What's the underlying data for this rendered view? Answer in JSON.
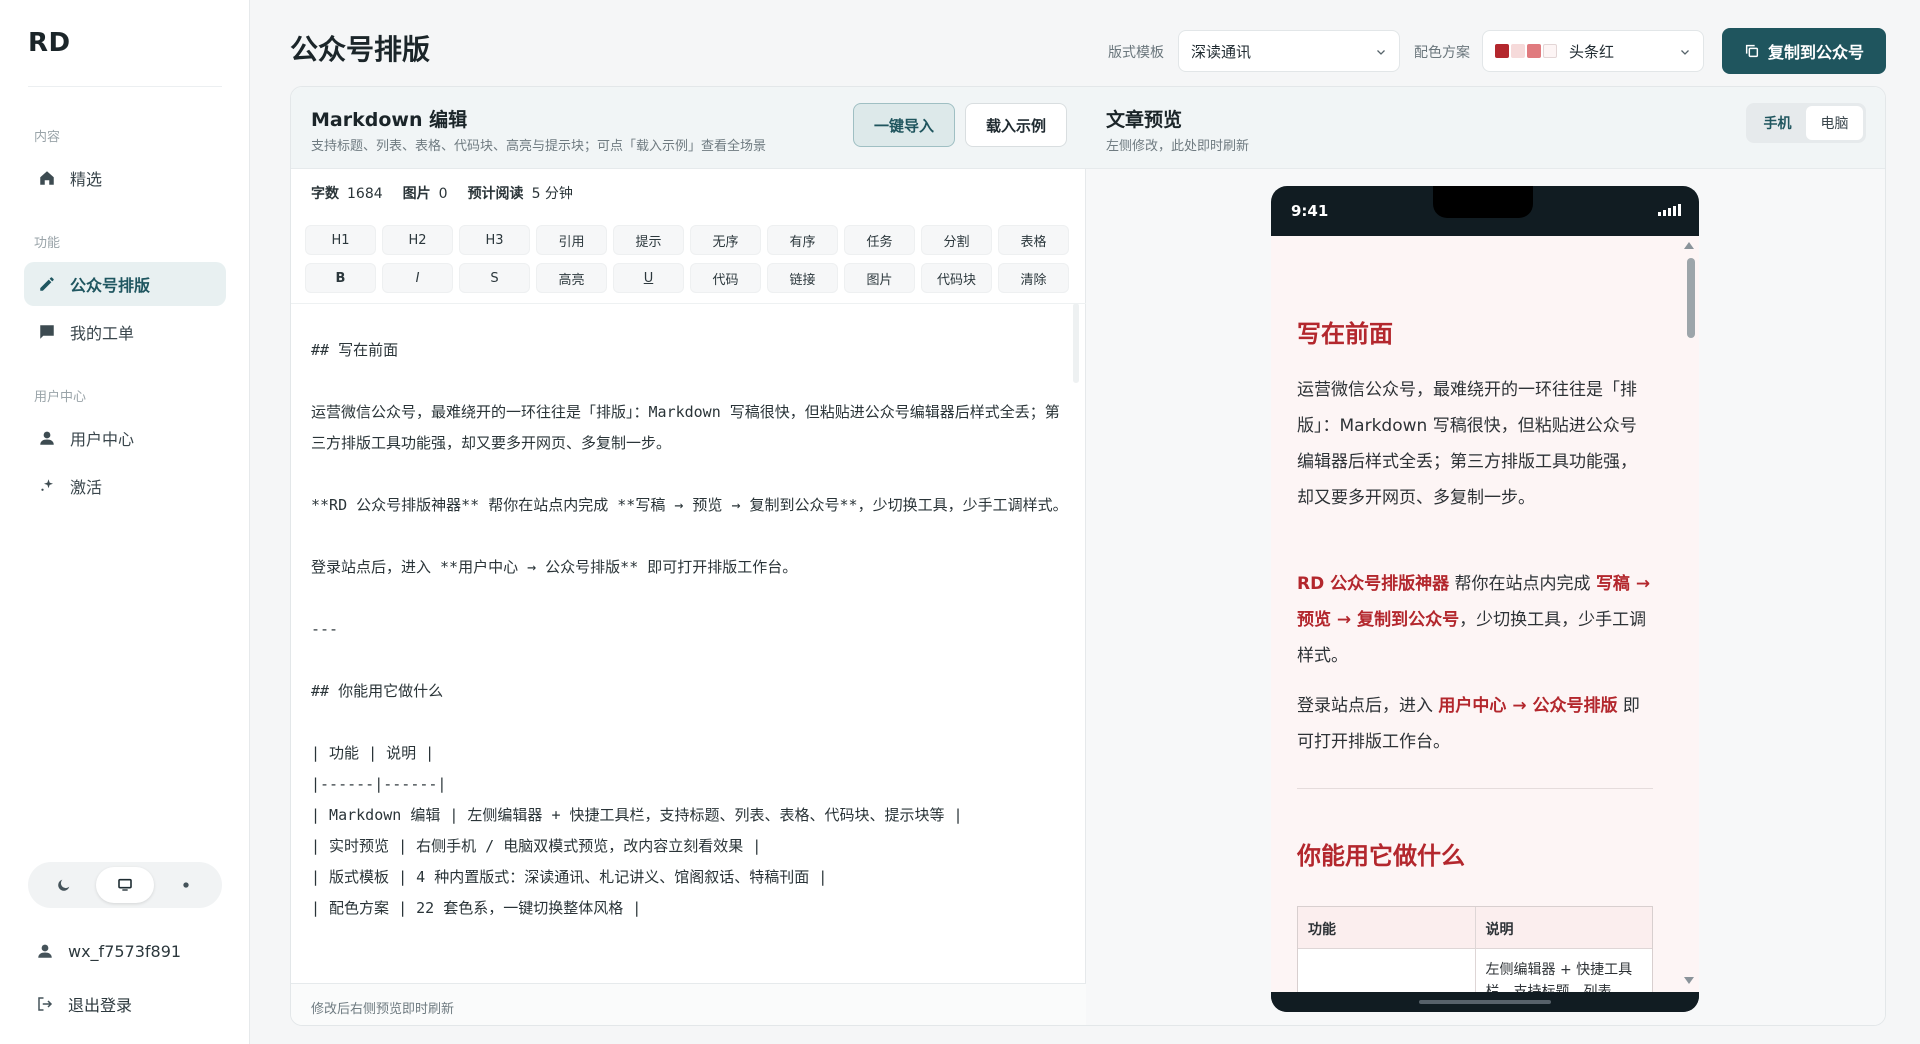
{
  "app": {
    "logo": "RD"
  },
  "sidebar": {
    "sections": [
      {
        "label": "内容"
      },
      {
        "label": "功能"
      },
      {
        "label": "用户中心"
      }
    ],
    "items": [
      {
        "label": "精选",
        "icon": "home-icon"
      },
      {
        "label": "公众号排版",
        "icon": "pencil-icon",
        "active": true
      },
      {
        "label": "我的工单",
        "icon": "chat-icon"
      },
      {
        "label": "用户中心",
        "icon": "user-icon"
      },
      {
        "label": "激活",
        "icon": "sparkle-icon"
      }
    ],
    "theme": {
      "options": [
        "moon-icon",
        "monitor-icon",
        "sun-icon"
      ],
      "selected": "monitor-icon"
    },
    "username": "wx_f7573f891",
    "logout": "退出登录"
  },
  "header": {
    "title": "公众号排版",
    "template_label": "版式模板",
    "template_value": "深读通讯",
    "color_label": "配色方案",
    "color_value": "头条红",
    "color_swatches": [
      "#b3272d",
      "#f6dada",
      "#e07a7e",
      "#fdf5f5"
    ],
    "copy_button": "复制到公众号"
  },
  "editor": {
    "title": "Markdown 编辑",
    "subtitle": "支持标题、列表、表格、代码块、高亮与提示块；可点「载入示例」查看全场景",
    "import_button": "一键导入",
    "example_button": "载入示例",
    "stats": [
      {
        "label": "字数",
        "value": "1684"
      },
      {
        "label": "图片",
        "value": "0"
      },
      {
        "label": "预计阅读",
        "value": "5 分钟"
      }
    ],
    "toolbar": [
      "H1",
      "H2",
      "H3",
      "引用",
      "提示",
      "无序",
      "有序",
      "任务",
      "分割",
      "表格",
      "B",
      "I",
      "S",
      "高亮",
      "U",
      "代码",
      "链接",
      "图片",
      "代码块",
      "清除"
    ],
    "content": "\n## 写在前面\n\n运营微信公众号，最难绕开的一环往往是「排版」：Markdown 写稿很快，但粘贴进公众号编辑器后样式全丢；第三方排版工具功能强，却又要多开网页、多复制一步。\n\n**RD 公众号排版神器** 帮你在站点内完成 **写稿 → 预览 → 复制到公众号**，少切换工具，少手工调样式。\n\n登录站点后，进入 **用户中心 → 公众号排版** 即可打开排版工作台。\n\n---\n\n## 你能用它做什么\n\n| 功能 | 说明 |\n|------|------|\n| Markdown 编辑 | 左侧编辑器 + 快捷工具栏，支持标题、列表、表格、代码块、提示块等 |\n| 实时预览 | 右侧手机 / 电脑双模式预览，改内容立刻看效果 |\n| 版式模板 | 4 种内置版式：深读通讯、札记讲义、馆阁叙话、特稿刊面 |\n| 配色方案 | 22 套色系，一键切换整体风格 |",
    "footer": "修改后右侧预览即时刷新"
  },
  "preview": {
    "title": "文章预览",
    "subtitle": "左侧修改，此处即时刷新",
    "modes": [
      "手机",
      "电脑"
    ],
    "selected_mode": "手机",
    "phone_time": "9:41",
    "article": {
      "h1": "写在前面",
      "p1": "运营微信公众号，最难绕开的一环往往是「排版」：Markdown 写稿很快，但粘贴进公众号编辑器后样式全丢；第三方排版工具功能强，却又要多开网页、多复制一步。",
      "p2_strong1": "RD 公众号排版神器",
      "p2_mid": " 帮你在站点内完成 ",
      "p2_strong2": "写稿 → 预览 → 复制到公众号",
      "p2_end": "，少切换工具，少手工调样式。",
      "p3_start": "登录站点后，进入 ",
      "p3_strong": "用户中心 → 公众号排版",
      "p3_end": " 即可打开排版工作台。",
      "h2": "你能用它做什么",
      "table_headers": [
        "功能",
        "说明"
      ],
      "table_row1": [
        "",
        "左侧编辑器 + 快捷工具栏，支持标题、列表"
      ]
    }
  }
}
